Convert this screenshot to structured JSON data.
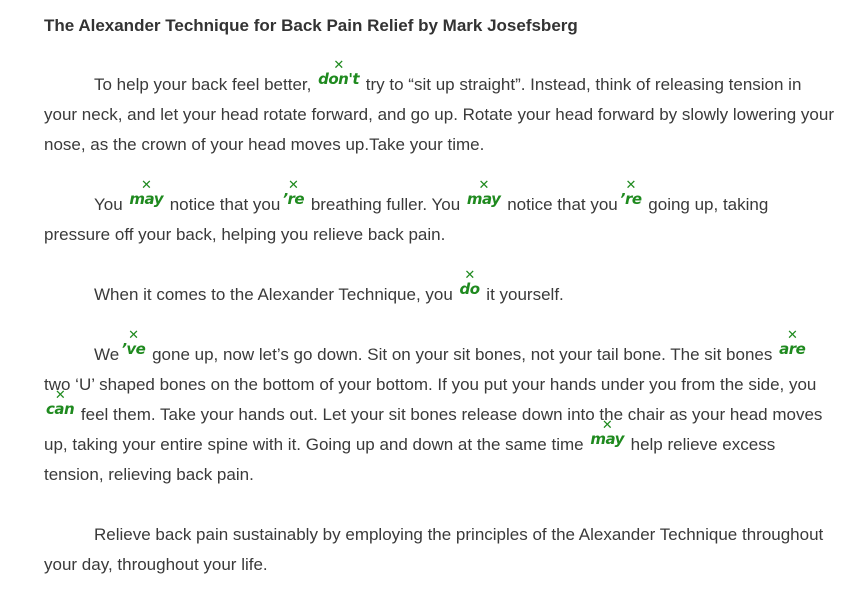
{
  "article": {
    "title": "The Alexander Technique for Back Pain Relief by Mark Josefsberg",
    "badge_mark": "✕",
    "paragraphs": [
      [
        {
          "t": "To help your back feel better, "
        },
        {
          "b": "don't"
        },
        {
          "t": " try to “sit up straight”. Instead, think of releasing tension in your neck, and let your head rotate forward, and go up. Rotate your head forward by slowly lowering your nose, as the crown of your head moves up.Take your time."
        }
      ],
      [
        {
          "t": "You "
        },
        {
          "b": "may"
        },
        {
          "t": " notice that you"
        },
        {
          "b": "’re"
        },
        {
          "t": " breathing fuller. You "
        },
        {
          "b": "may"
        },
        {
          "t": " notice that you"
        },
        {
          "b": "’re"
        },
        {
          "t": " going up, taking pressure off your back, helping you relieve back pain."
        }
      ],
      [
        {
          "t": "When it comes to the Alexander Technique, you "
        },
        {
          "b": "do"
        },
        {
          "t": " it yourself."
        }
      ],
      [
        {
          "t": "We"
        },
        {
          "b": "’ve"
        },
        {
          "t": " gone up, now let’s go down. Sit on your sit bones, not your tail bone. The sit bones "
        },
        {
          "b": "are"
        },
        {
          "t": " two ‘U’ shaped bones on the bottom of your bottom. If you put your hands under you from the side, you "
        },
        {
          "b": "can"
        },
        {
          "t": " feel them. Take your hands out. Let your sit bones release down into the chair as your head moves up, taking your entire spine with it. Going up and down at the same time "
        },
        {
          "b": "may"
        },
        {
          "t": " help relieve excess tension, relieving back pain."
        }
      ],
      [
        {
          "t": "Relieve back pain sustainably by employing the principles of the Alexander Technique throughout your day, throughout your life."
        }
      ]
    ]
  }
}
